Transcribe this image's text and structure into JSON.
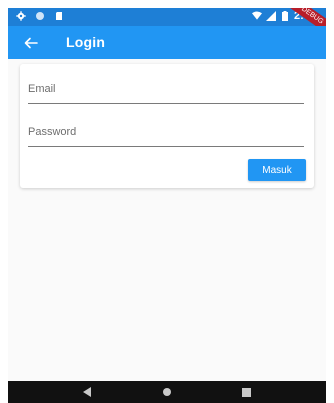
{
  "status_bar": {
    "time": "2:40",
    "icons": [
      "gear-icon",
      "circle-icon",
      "sd-card-icon",
      "wifi-icon",
      "signal-icon",
      "battery-icon"
    ]
  },
  "app_bar": {
    "title": "Login",
    "back_icon": "arrow-left-icon",
    "color": "#2196f3"
  },
  "form": {
    "email": {
      "placeholder": "Email",
      "value": ""
    },
    "password": {
      "placeholder": "Password",
      "value": ""
    },
    "submit_label": "Masuk"
  },
  "debug_banner": "DEBUG",
  "nav_bar": {
    "icons": [
      "back-triangle-icon",
      "home-circle-icon",
      "recents-square-icon"
    ]
  }
}
